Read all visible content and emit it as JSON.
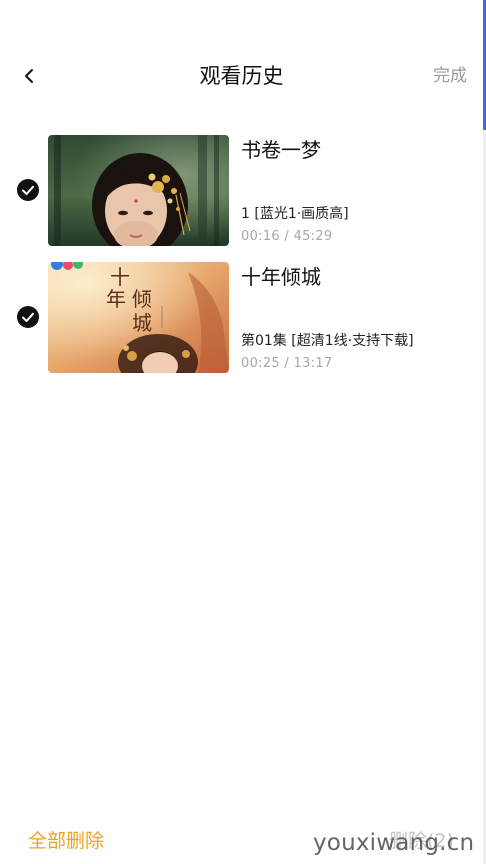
{
  "header": {
    "title": "观看历史",
    "done_label": "完成"
  },
  "history": [
    {
      "title": "书卷一梦",
      "episode": "1 [蓝光1·画质高]",
      "progress": "00:16 / 45:29",
      "selected": true
    },
    {
      "title": "十年倾城",
      "episode": "第01集 [超清1线·支持下载]",
      "progress": "00:25 / 13:17",
      "selected": true,
      "poster_text": [
        "十",
        "年",
        "倾",
        "城"
      ]
    }
  ],
  "footer": {
    "delete_all_label": "全部删除",
    "delete_label": "删除(2)"
  },
  "watermark": "youxiwang.cn",
  "colors": {
    "accent_orange": "#f0a21e",
    "muted_text": "#a8a8a8",
    "disabled_text": "#c4c4c4"
  }
}
